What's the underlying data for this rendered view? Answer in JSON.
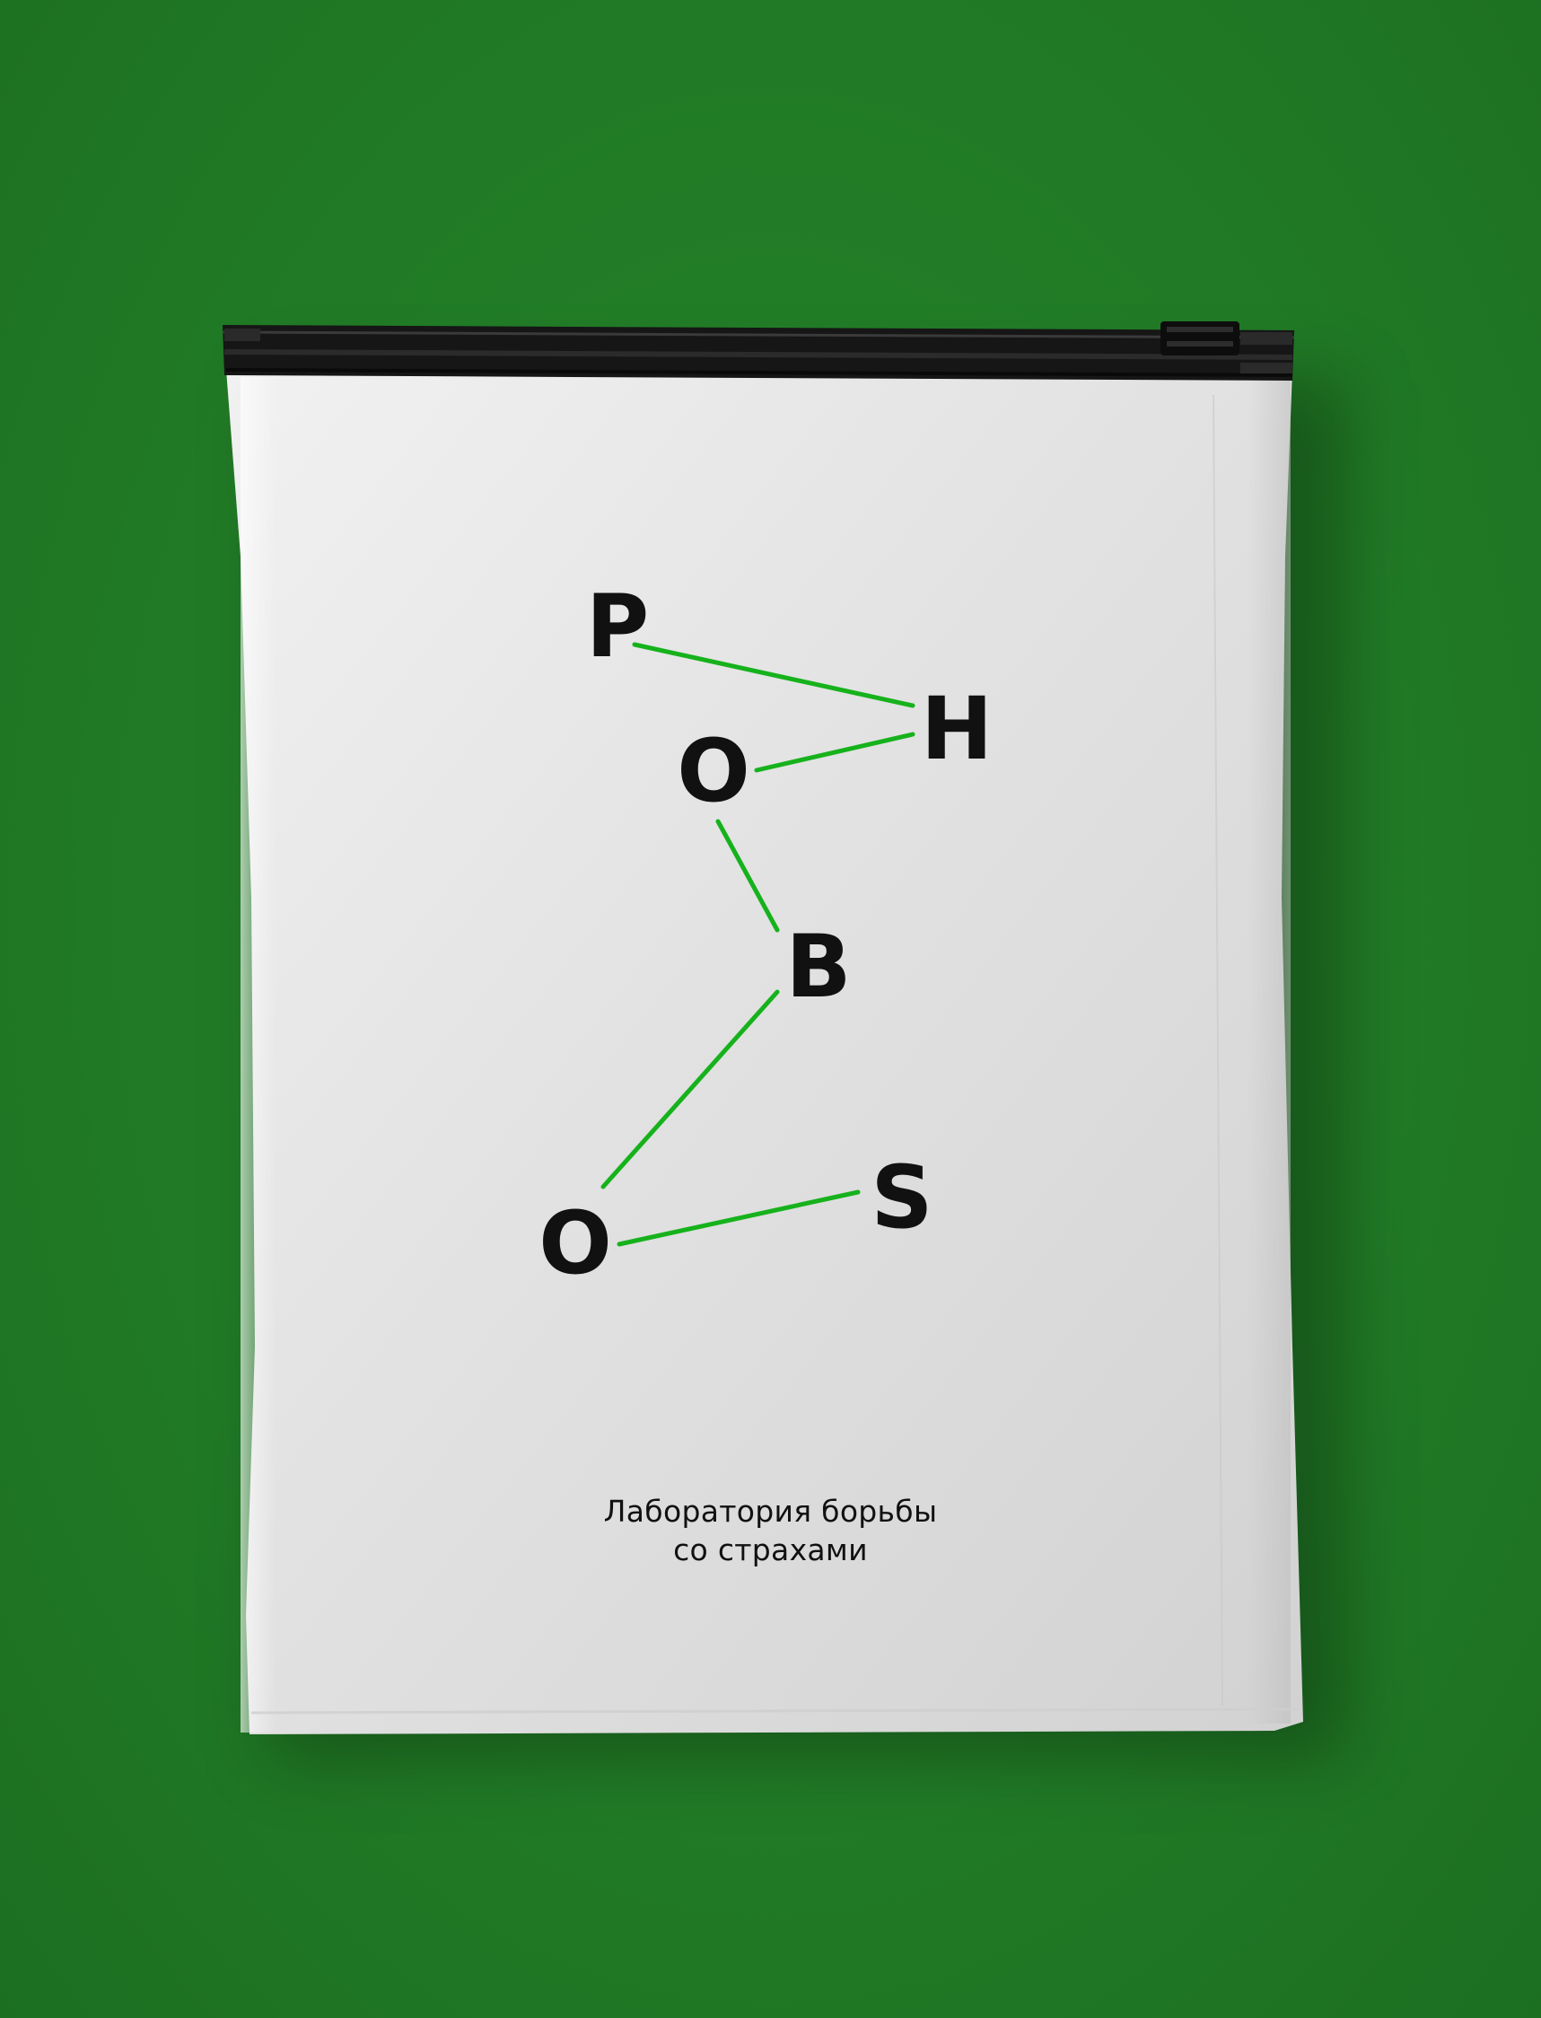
{
  "background_color": "#217b26",
  "accent_color": "#16b21c",
  "bag_color": "#e4e4e4",
  "zipper_color": "#151515",
  "logo_letters": {
    "p": "P",
    "h": "H",
    "o1": "O",
    "b": "B",
    "o2": "O",
    "s": "S"
  },
  "tagline": {
    "line1": "Лаборатория борьбы",
    "line2": "со страхами"
  }
}
